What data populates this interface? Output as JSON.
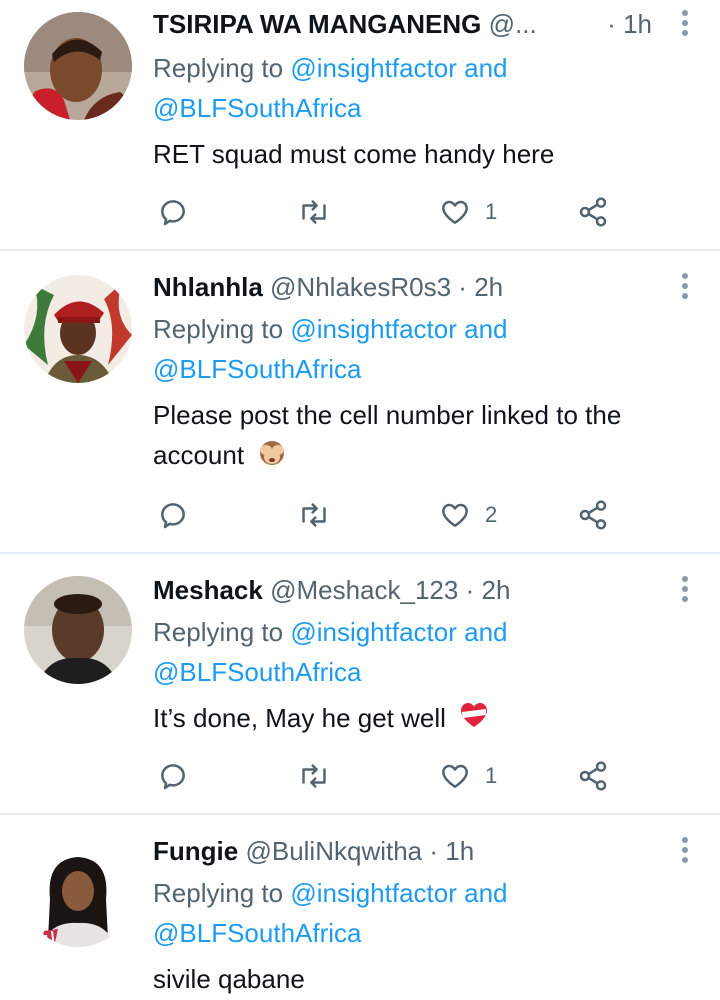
{
  "tweets": [
    {
      "name": "TSIRIPA WA MANGANENG",
      "handle": "@...",
      "dot": "·",
      "time": "1h",
      "replying_prefix": "Replying to",
      "mention1": "@insightfactor",
      "and": "and",
      "mention2": "@BLFSouthAfrica",
      "text": "RET squad must come handy here",
      "likes": "1"
    },
    {
      "name": "Nhlanhla",
      "handle": "@NhlakesR0s3",
      "dot": "·",
      "time": "2h",
      "replying_prefix": "Replying to",
      "mention1": "@insightfactor",
      "and": "and",
      "mention2": "@BLFSouthAfrica",
      "text_line1": "Please post the cell number linked to the",
      "text_line2": "account",
      "likes": "2"
    },
    {
      "name": "Meshack",
      "handle": "@Meshack_123",
      "dot": "·",
      "time": "2h",
      "replying_prefix": "Replying to",
      "mention1": "@insightfactor",
      "and": "and",
      "mention2": "@BLFSouthAfrica",
      "text": "It’s done, May he get well",
      "likes": "1"
    },
    {
      "name": "Fungie",
      "handle": "@BuliNkqwitha",
      "dot": "·",
      "time": "1h",
      "replying_prefix": "Replying to",
      "mention1": "@insightfactor",
      "and": "and",
      "mention2": "@BLFSouthAfrica",
      "text": "sivile qabane"
    }
  ],
  "icons": {
    "reply": "reply-icon",
    "retweet": "retweet-icon",
    "like": "heart-icon",
    "share": "share-icon",
    "more": "more-vertical-icon"
  },
  "colors": {
    "link": "#1d9bf0",
    "muted": "#536471",
    "text": "#0f1419",
    "divider": "#e6ecf0"
  }
}
